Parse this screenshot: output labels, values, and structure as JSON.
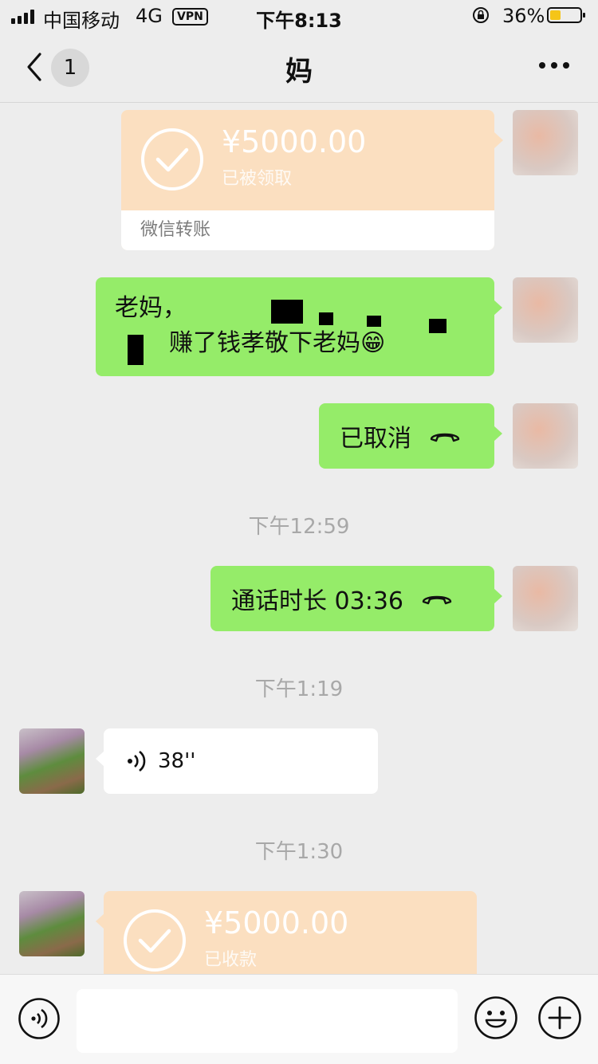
{
  "status_bar": {
    "carrier": "中国移动",
    "network": "4G",
    "vpn": "VPN",
    "time": "下午8:13",
    "battery_percent": "36%",
    "battery_level": 0.36
  },
  "nav": {
    "title": "妈",
    "unread_count": "1"
  },
  "messages": {
    "transfer_sent": {
      "amount": "¥5000.00",
      "status": "已被领取",
      "footer": "微信转账"
    },
    "text_line1": "老妈，",
    "text_line2": "赚了钱孝敬下老妈",
    "text_emoji": "😁",
    "call_cancelled": "已取消",
    "time1": "下午12:59",
    "call_duration": "通话时长 03:36",
    "time2": "下午1:19",
    "voice_duration": "38''",
    "time3": "下午1:30",
    "transfer_received": {
      "amount": "¥5000.00",
      "status": "已收款"
    }
  },
  "colors": {
    "background": "#ededed",
    "bubble_green": "#95ec69",
    "transfer_orange": "#fbdfc0"
  },
  "icons": [
    "back-arrow-icon",
    "more-icon",
    "hangup-icon",
    "voice-wave-icon",
    "check-circle-icon",
    "voice-input-icon",
    "emoji-icon",
    "plus-icon"
  ]
}
